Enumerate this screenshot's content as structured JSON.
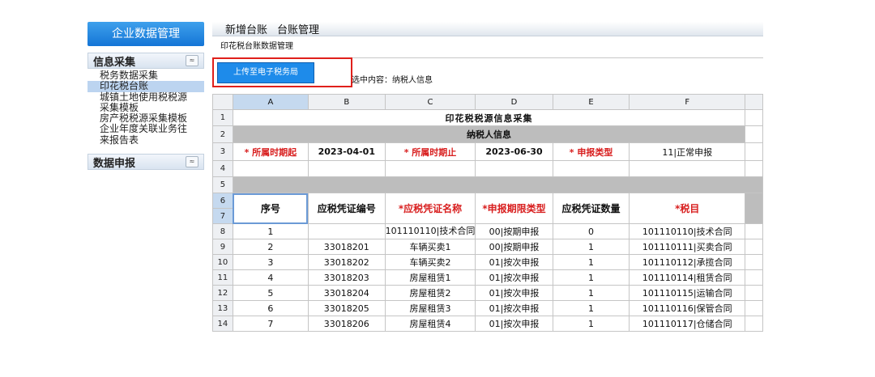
{
  "sidebar": {
    "title": "企业数据管理",
    "section1": {
      "label": "信息采集",
      "chevron": "≈"
    },
    "items": [
      "税务数据采集",
      "印花税台账",
      "城镇土地使用税税源",
      "采集模板",
      "房产税税源采集模板",
      "企业年度关联业务往",
      "来报告表"
    ],
    "section2": {
      "label": "数据申报",
      "chevron": "≈"
    }
  },
  "menu": {
    "item1": "新增台账",
    "item2": "台账管理"
  },
  "breadcrumb": "印花税台账数据管理",
  "upload_button": "上传至电子税务局",
  "selection_info": "选中内容：纳税人信息",
  "columns": [
    "A",
    "B",
    "C",
    "D",
    "E",
    "F"
  ],
  "row_numbers": [
    "1",
    "2",
    "3",
    "4",
    "5",
    "6",
    "7",
    "8",
    "9",
    "10",
    "11",
    "12",
    "13",
    "14"
  ],
  "sheet": {
    "title": "印花税税源信息采集",
    "band_label": "纳税人信息",
    "period_start_label": "* 所属时期起",
    "period_start_value": "2023-04-01",
    "period_end_label": "* 所属时期止",
    "period_end_value": "2023-06-30",
    "report_type_label": "* 申报类型",
    "report_type_value": "11|正常申报",
    "headers": {
      "seq": "序号",
      "voucher_no": "应税凭证编号",
      "voucher_name": "*应税凭证名称",
      "period_type": "*申报期限类型",
      "voucher_count": "应税凭证数量",
      "tax_item": "*税目"
    },
    "rows": [
      {
        "seq": "1",
        "no": "",
        "name": "101110110|技术合同",
        "period": "00|按期申报",
        "count": "0",
        "item": "101110110|技术合同"
      },
      {
        "seq": "2",
        "no": "33018201",
        "name": "车辆买卖1",
        "period": "00|按期申报",
        "count": "1",
        "item": "101110111|买卖合同"
      },
      {
        "seq": "3",
        "no": "33018202",
        "name": "车辆买卖2",
        "period": "01|按次申报",
        "count": "1",
        "item": "101110112|承揽合同"
      },
      {
        "seq": "4",
        "no": "33018203",
        "name": "房屋租赁1",
        "period": "01|按次申报",
        "count": "1",
        "item": "101110114|租赁合同"
      },
      {
        "seq": "5",
        "no": "33018204",
        "name": "房屋租赁2",
        "period": "01|按次申报",
        "count": "1",
        "item": "101110115|运输合同"
      },
      {
        "seq": "6",
        "no": "33018205",
        "name": "房屋租赁3",
        "period": "01|按次申报",
        "count": "1",
        "item": "101110116|保管合同"
      },
      {
        "seq": "7",
        "no": "33018206",
        "name": "房屋租赁4",
        "period": "01|按次申报",
        "count": "1",
        "item": "101110117|仓储合同"
      }
    ]
  },
  "colors": {
    "accent": "#1e8bea",
    "highlight": "#e0201b",
    "band": "#bdbdbd",
    "required": "#d81e1e"
  }
}
